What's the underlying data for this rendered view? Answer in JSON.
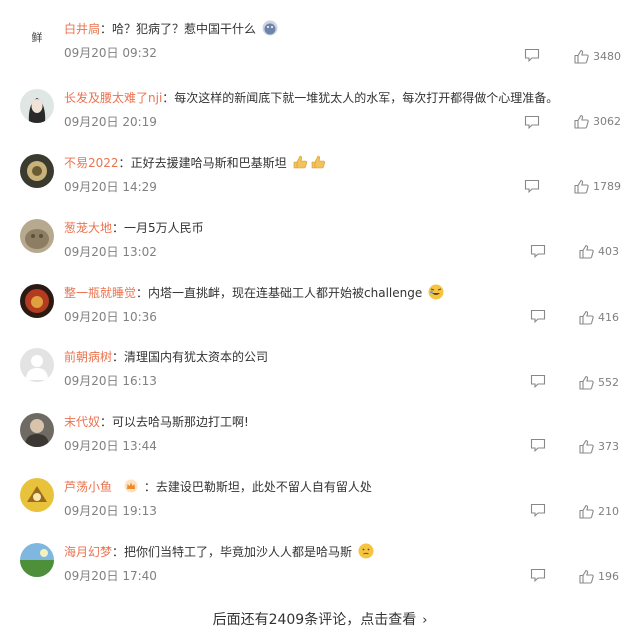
{
  "comments": [
    {
      "user": "白井扃",
      "text": "哈？犯病了？惹中国干什么",
      "time": "09月20日 09:32",
      "likes": "3480"
    },
    {
      "user": "长发及腰太难了nji",
      "text": "每次这样的新闻底下就一堆犹太人的水军，每次打开都得做个心理准备。",
      "time": "09月20日 20:19",
      "likes": "3062"
    },
    {
      "user": "不易2022",
      "text": "正好去援建哈马斯和巴基斯坦",
      "time": "09月20日 14:29",
      "likes": "1789"
    },
    {
      "user": "葱茏大地",
      "text": "一月5万人民币",
      "time": "09月20日 13:02",
      "likes": "403"
    },
    {
      "user": "整一瓶就睡觉",
      "text": "内塔一直挑衅，现在连基础工人都开始被challenge",
      "time": "09月20日 10:36",
      "likes": "416"
    },
    {
      "user": "前朝病树",
      "text": "清理国内有犹太资本的公司",
      "time": "09月20日 16:13",
      "likes": "552"
    },
    {
      "user": "末代奴",
      "text": "可以去哈马斯那边打工啊!",
      "time": "09月20日 13:44",
      "likes": "373"
    },
    {
      "user": "芦荡小鱼",
      "text": "去建设巴勒斯坦，此处不留人自有留人处",
      "time": "09月20日 19:13",
      "likes": "210"
    },
    {
      "user": "海月幻梦",
      "text": "把你们当特工了，毕竟加沙人人都是哈马斯",
      "time": "09月20日 17:40",
      "likes": "196"
    }
  ],
  "avatar_text": "鲜",
  "colon": "：",
  "more_comments": "后面还有2409条评论，点击查看",
  "more_chevron": "›",
  "colors": {
    "username": "#eb7350",
    "text": "#333333",
    "meta": "#808080"
  }
}
